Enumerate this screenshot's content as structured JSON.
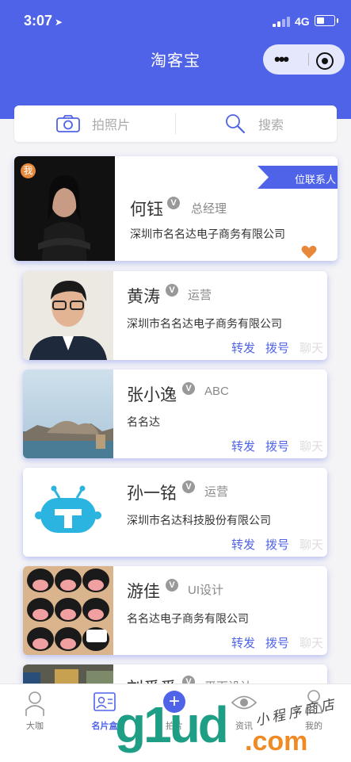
{
  "status_bar": {
    "time": "3:07",
    "network": "4G"
  },
  "header": {
    "title": "淘客宝"
  },
  "search_bar": {
    "photo_label": "拍照片",
    "search_label": "搜索"
  },
  "contacts": [
    {
      "badge": "我",
      "name": "何钰",
      "role": "总经理",
      "company": "深圳市名名达电子商务有限公司",
      "ribbon": "位联系人"
    },
    {
      "name": "黄涛",
      "role": "运营",
      "company": "深圳市名名达电子商务有限公司",
      "actions": [
        "转发",
        "拨号",
        "聊天"
      ]
    },
    {
      "name": "张小逸",
      "role": "ABC",
      "company": "名名达",
      "actions": [
        "转发",
        "拨号",
        "聊天"
      ]
    },
    {
      "name": "孙一铭",
      "role": "运营",
      "company": "深圳市名达科技股份有限公司",
      "actions": [
        "转发",
        "拨号",
        "聊天"
      ]
    },
    {
      "name": "游佳",
      "role": "UI设计",
      "company": "名名达电子商务有限公司",
      "actions": [
        "转发",
        "拨号",
        "聊天"
      ]
    },
    {
      "name": "刘番番",
      "role": "平面设计"
    }
  ],
  "tabs": [
    {
      "label": "大咖",
      "icon": "person-icon"
    },
    {
      "label": "名片盒",
      "icon": "card-icon",
      "active": true
    },
    {
      "label": "拍片",
      "icon": "plus-icon"
    },
    {
      "label": "资讯",
      "icon": "eye-icon"
    },
    {
      "label": "我的",
      "icon": "user-icon"
    }
  ],
  "watermark": {
    "text": "g1ud",
    "domain": ".com",
    "script": "小程序商店"
  },
  "colors": {
    "primary": "#4f63e8",
    "heart": "#e8883a",
    "badge": "#e8883a"
  }
}
